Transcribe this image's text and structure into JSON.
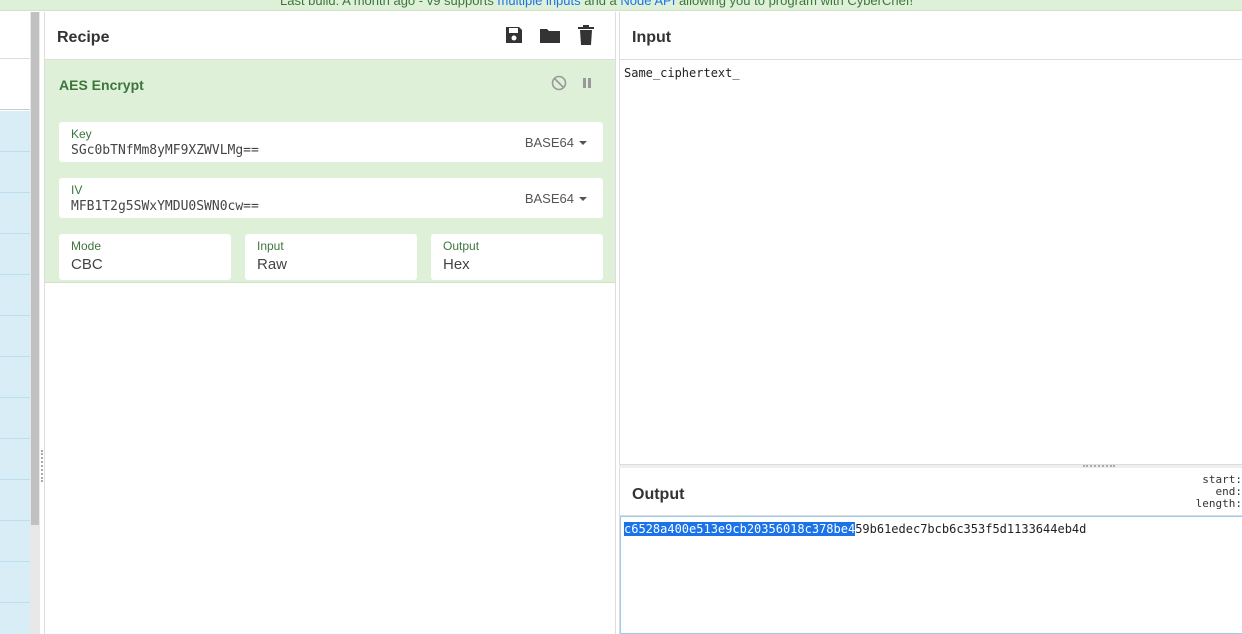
{
  "banner": {
    "text_a": "Last build: A month ago",
    "text_b": " - v9 supports ",
    "link_a": "multiple inputs",
    "text_c": " and a ",
    "link_b": "Node API",
    "text_d": " allowing you to program with CyberChef!"
  },
  "recipe": {
    "title": "Recipe",
    "tools": {
      "save": "save-icon",
      "load": "folder-icon",
      "clear": "trash-icon"
    },
    "operation": {
      "name": "AES Encrypt",
      "key": {
        "label": "Key",
        "value": "SGc0bTNfMm8yMF9XZWVLMg==",
        "encoding": "BASE64"
      },
      "iv": {
        "label": "IV",
        "value": "MFB1T2g5SWxYMDU0SWN0cw==",
        "encoding": "BASE64"
      },
      "mode": {
        "label": "Mode",
        "value": "CBC"
      },
      "input": {
        "label": "Input",
        "value": "Raw"
      },
      "output": {
        "label": "Output",
        "value": "Hex"
      }
    }
  },
  "input": {
    "title": "Input",
    "value": "Same_ciphertext_"
  },
  "output": {
    "title": "Output",
    "stats": {
      "start": "start:",
      "end": "end:",
      "length": "length:"
    },
    "selected": "c6528a400e513e9cb20356018c378be4",
    "rest": "59b61edec7bcb6c353f5d1133644eb4d"
  },
  "colors": {
    "accent_green": "#3c763d",
    "op_bg": "#dff0d8",
    "selection": "#1a73e8"
  }
}
